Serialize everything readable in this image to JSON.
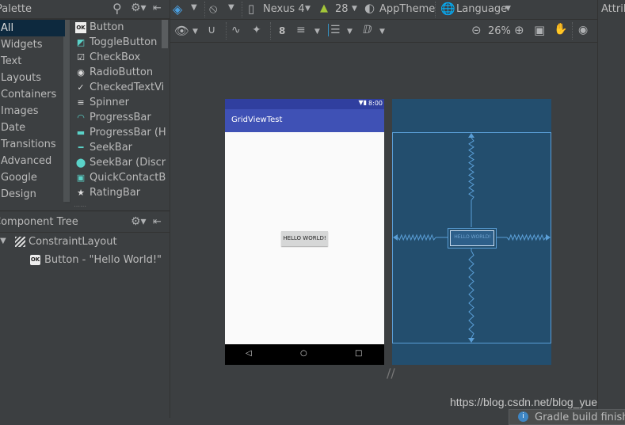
{
  "palette": {
    "title": "Palette",
    "categories": [
      "All",
      "Widgets",
      "Text",
      "Layouts",
      "Containers",
      "Images",
      "Date",
      "Transitions",
      "Advanced",
      "Google",
      "Design"
    ],
    "items": [
      "Button",
      "ToggleButton",
      "CheckBox",
      "RadioButton",
      "CheckedTextVi",
      "Spinner",
      "ProgressBar",
      "ProgressBar (H",
      "SeekBar",
      "SeekBar (Discr",
      "QuickContactB",
      "RatingBar"
    ]
  },
  "toolbar": {
    "device": "Nexus 4",
    "api": "28",
    "theme": "AppTheme",
    "language": "Language",
    "zoom": "26%",
    "margin": "8"
  },
  "attributes": {
    "title": "Attrib"
  },
  "component_tree": {
    "title": "Component Tree",
    "root": "ConstraintLayout",
    "child": "Button - \"Hello World!\""
  },
  "device": {
    "time": "8:00",
    "app_title": "GridViewTest",
    "button": "HELLO WORLD!"
  },
  "watermark": "https://blog.csdn.net/blog_yue",
  "notification": "Gradle build finished"
}
